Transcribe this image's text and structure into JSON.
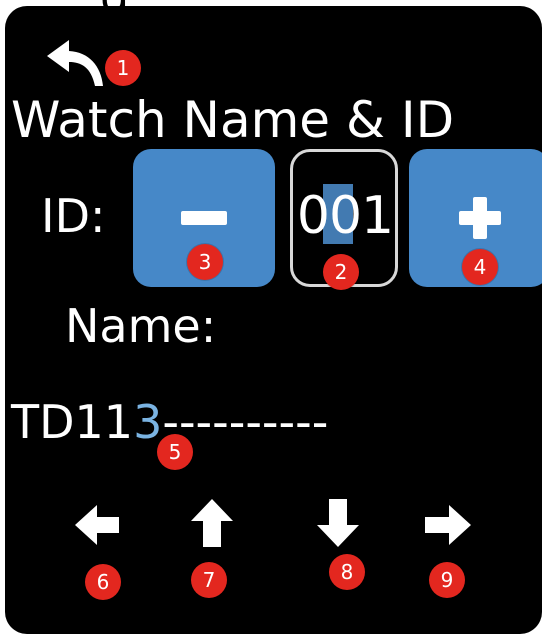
{
  "screen": {
    "header_fragment": "g",
    "title": "Watch Name & ID",
    "id_label": "ID:",
    "id_value": "001",
    "name_label": "Name:",
    "name": {
      "prefix": "TD11",
      "cursor_char": "3",
      "suffix": "----------"
    }
  },
  "badges": {
    "back": "1",
    "id_value": "2",
    "minus": "3",
    "plus": "4",
    "name_field": "5",
    "left": "6",
    "up": "7",
    "down": "8",
    "right": "9"
  },
  "icons": {
    "back": "back-arrow-icon",
    "minus": "minus-icon",
    "plus": "plus-icon",
    "left": "arrow-left-icon",
    "up": "arrow-up-icon",
    "down": "arrow-down-icon",
    "right": "arrow-right-icon"
  },
  "colors": {
    "background": "#000000",
    "button": "#4688c8",
    "badge": "#e3271f",
    "cursor": "#4d8fd0"
  }
}
